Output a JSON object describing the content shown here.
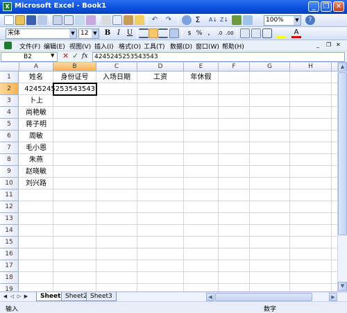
{
  "window": {
    "title": "Microsoft Excel - Book1",
    "app_icon": "X",
    "minimize": "_",
    "restore": "❐",
    "close": "✕"
  },
  "standard_toolbar": {
    "zoom": "100%",
    "help": "?"
  },
  "formatting_toolbar": {
    "font": "宋体",
    "font_size": "12",
    "bold": "B",
    "italic": "I",
    "underline": "U",
    "currency": "%",
    "comma": ",",
    "font_color_label": "A",
    "accent_color": "#d00000",
    "fill_color": "#ffff00"
  },
  "menu": [
    "文件(F)",
    "编辑(E)",
    "视图(V)",
    "插入(I)",
    "格式(O)",
    "工具(T)",
    "数据(D)",
    "窗口(W)",
    "帮助(H)"
  ],
  "formula_bar": {
    "name_box": "B2",
    "cancel": "✕",
    "enter": "✓",
    "fx": "fx",
    "value": "4245245253543543"
  },
  "columns": [
    "A",
    "B",
    "C",
    "D",
    "E",
    "F",
    "G",
    "H",
    "I"
  ],
  "rows": [
    "1",
    "2",
    "3",
    "4",
    "5",
    "6",
    "7",
    "8",
    "9",
    "10",
    "11",
    "12",
    "13",
    "14",
    "15",
    "16",
    "17",
    "18",
    "19"
  ],
  "cells": {
    "A1": "姓名",
    "B1": "身份证号",
    "C1": "入场日期",
    "D1": "工资",
    "E1": "年休假",
    "B2": "4245245253543543",
    "A3": "卜上",
    "A4": "尚艳敏",
    "A5": "蒋子明",
    "A6": "周敏",
    "A7": "毛小恩",
    "A8": "朱燕",
    "A9": "赵晓敏",
    "A10": "刘兴路"
  },
  "selected_cell": "B2",
  "sheets": [
    "Sheet1",
    "Sheet2",
    "Sheet3"
  ],
  "active_sheet": "Sheet1",
  "status": {
    "mode": "输入",
    "num": "数字"
  }
}
